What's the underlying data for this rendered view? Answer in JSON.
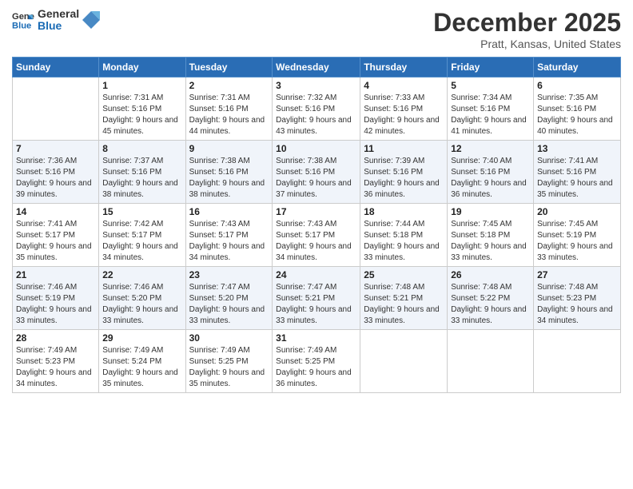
{
  "header": {
    "logo_general": "General",
    "logo_blue": "Blue",
    "month_title": "December 2025",
    "location": "Pratt, Kansas, United States"
  },
  "days_of_week": [
    "Sunday",
    "Monday",
    "Tuesday",
    "Wednesday",
    "Thursday",
    "Friday",
    "Saturday"
  ],
  "weeks": [
    [
      {
        "day": "",
        "sunrise": "",
        "sunset": "",
        "daylight": ""
      },
      {
        "day": "1",
        "sunrise": "Sunrise: 7:31 AM",
        "sunset": "Sunset: 5:16 PM",
        "daylight": "Daylight: 9 hours and 45 minutes."
      },
      {
        "day": "2",
        "sunrise": "Sunrise: 7:31 AM",
        "sunset": "Sunset: 5:16 PM",
        "daylight": "Daylight: 9 hours and 44 minutes."
      },
      {
        "day": "3",
        "sunrise": "Sunrise: 7:32 AM",
        "sunset": "Sunset: 5:16 PM",
        "daylight": "Daylight: 9 hours and 43 minutes."
      },
      {
        "day": "4",
        "sunrise": "Sunrise: 7:33 AM",
        "sunset": "Sunset: 5:16 PM",
        "daylight": "Daylight: 9 hours and 42 minutes."
      },
      {
        "day": "5",
        "sunrise": "Sunrise: 7:34 AM",
        "sunset": "Sunset: 5:16 PM",
        "daylight": "Daylight: 9 hours and 41 minutes."
      },
      {
        "day": "6",
        "sunrise": "Sunrise: 7:35 AM",
        "sunset": "Sunset: 5:16 PM",
        "daylight": "Daylight: 9 hours and 40 minutes."
      }
    ],
    [
      {
        "day": "7",
        "sunrise": "Sunrise: 7:36 AM",
        "sunset": "Sunset: 5:16 PM",
        "daylight": "Daylight: 9 hours and 39 minutes."
      },
      {
        "day": "8",
        "sunrise": "Sunrise: 7:37 AM",
        "sunset": "Sunset: 5:16 PM",
        "daylight": "Daylight: 9 hours and 38 minutes."
      },
      {
        "day": "9",
        "sunrise": "Sunrise: 7:38 AM",
        "sunset": "Sunset: 5:16 PM",
        "daylight": "Daylight: 9 hours and 38 minutes."
      },
      {
        "day": "10",
        "sunrise": "Sunrise: 7:38 AM",
        "sunset": "Sunset: 5:16 PM",
        "daylight": "Daylight: 9 hours and 37 minutes."
      },
      {
        "day": "11",
        "sunrise": "Sunrise: 7:39 AM",
        "sunset": "Sunset: 5:16 PM",
        "daylight": "Daylight: 9 hours and 36 minutes."
      },
      {
        "day": "12",
        "sunrise": "Sunrise: 7:40 AM",
        "sunset": "Sunset: 5:16 PM",
        "daylight": "Daylight: 9 hours and 36 minutes."
      },
      {
        "day": "13",
        "sunrise": "Sunrise: 7:41 AM",
        "sunset": "Sunset: 5:16 PM",
        "daylight": "Daylight: 9 hours and 35 minutes."
      }
    ],
    [
      {
        "day": "14",
        "sunrise": "Sunrise: 7:41 AM",
        "sunset": "Sunset: 5:17 PM",
        "daylight": "Daylight: 9 hours and 35 minutes."
      },
      {
        "day": "15",
        "sunrise": "Sunrise: 7:42 AM",
        "sunset": "Sunset: 5:17 PM",
        "daylight": "Daylight: 9 hours and 34 minutes."
      },
      {
        "day": "16",
        "sunrise": "Sunrise: 7:43 AM",
        "sunset": "Sunset: 5:17 PM",
        "daylight": "Daylight: 9 hours and 34 minutes."
      },
      {
        "day": "17",
        "sunrise": "Sunrise: 7:43 AM",
        "sunset": "Sunset: 5:17 PM",
        "daylight": "Daylight: 9 hours and 34 minutes."
      },
      {
        "day": "18",
        "sunrise": "Sunrise: 7:44 AM",
        "sunset": "Sunset: 5:18 PM",
        "daylight": "Daylight: 9 hours and 33 minutes."
      },
      {
        "day": "19",
        "sunrise": "Sunrise: 7:45 AM",
        "sunset": "Sunset: 5:18 PM",
        "daylight": "Daylight: 9 hours and 33 minutes."
      },
      {
        "day": "20",
        "sunrise": "Sunrise: 7:45 AM",
        "sunset": "Sunset: 5:19 PM",
        "daylight": "Daylight: 9 hours and 33 minutes."
      }
    ],
    [
      {
        "day": "21",
        "sunrise": "Sunrise: 7:46 AM",
        "sunset": "Sunset: 5:19 PM",
        "daylight": "Daylight: 9 hours and 33 minutes."
      },
      {
        "day": "22",
        "sunrise": "Sunrise: 7:46 AM",
        "sunset": "Sunset: 5:20 PM",
        "daylight": "Daylight: 9 hours and 33 minutes."
      },
      {
        "day": "23",
        "sunrise": "Sunrise: 7:47 AM",
        "sunset": "Sunset: 5:20 PM",
        "daylight": "Daylight: 9 hours and 33 minutes."
      },
      {
        "day": "24",
        "sunrise": "Sunrise: 7:47 AM",
        "sunset": "Sunset: 5:21 PM",
        "daylight": "Daylight: 9 hours and 33 minutes."
      },
      {
        "day": "25",
        "sunrise": "Sunrise: 7:48 AM",
        "sunset": "Sunset: 5:21 PM",
        "daylight": "Daylight: 9 hours and 33 minutes."
      },
      {
        "day": "26",
        "sunrise": "Sunrise: 7:48 AM",
        "sunset": "Sunset: 5:22 PM",
        "daylight": "Daylight: 9 hours and 33 minutes."
      },
      {
        "day": "27",
        "sunrise": "Sunrise: 7:48 AM",
        "sunset": "Sunset: 5:23 PM",
        "daylight": "Daylight: 9 hours and 34 minutes."
      }
    ],
    [
      {
        "day": "28",
        "sunrise": "Sunrise: 7:49 AM",
        "sunset": "Sunset: 5:23 PM",
        "daylight": "Daylight: 9 hours and 34 minutes."
      },
      {
        "day": "29",
        "sunrise": "Sunrise: 7:49 AM",
        "sunset": "Sunset: 5:24 PM",
        "daylight": "Daylight: 9 hours and 35 minutes."
      },
      {
        "day": "30",
        "sunrise": "Sunrise: 7:49 AM",
        "sunset": "Sunset: 5:25 PM",
        "daylight": "Daylight: 9 hours and 35 minutes."
      },
      {
        "day": "31",
        "sunrise": "Sunrise: 7:49 AM",
        "sunset": "Sunset: 5:25 PM",
        "daylight": "Daylight: 9 hours and 36 minutes."
      },
      {
        "day": "",
        "sunrise": "",
        "sunset": "",
        "daylight": ""
      },
      {
        "day": "",
        "sunrise": "",
        "sunset": "",
        "daylight": ""
      },
      {
        "day": "",
        "sunrise": "",
        "sunset": "",
        "daylight": ""
      }
    ]
  ]
}
